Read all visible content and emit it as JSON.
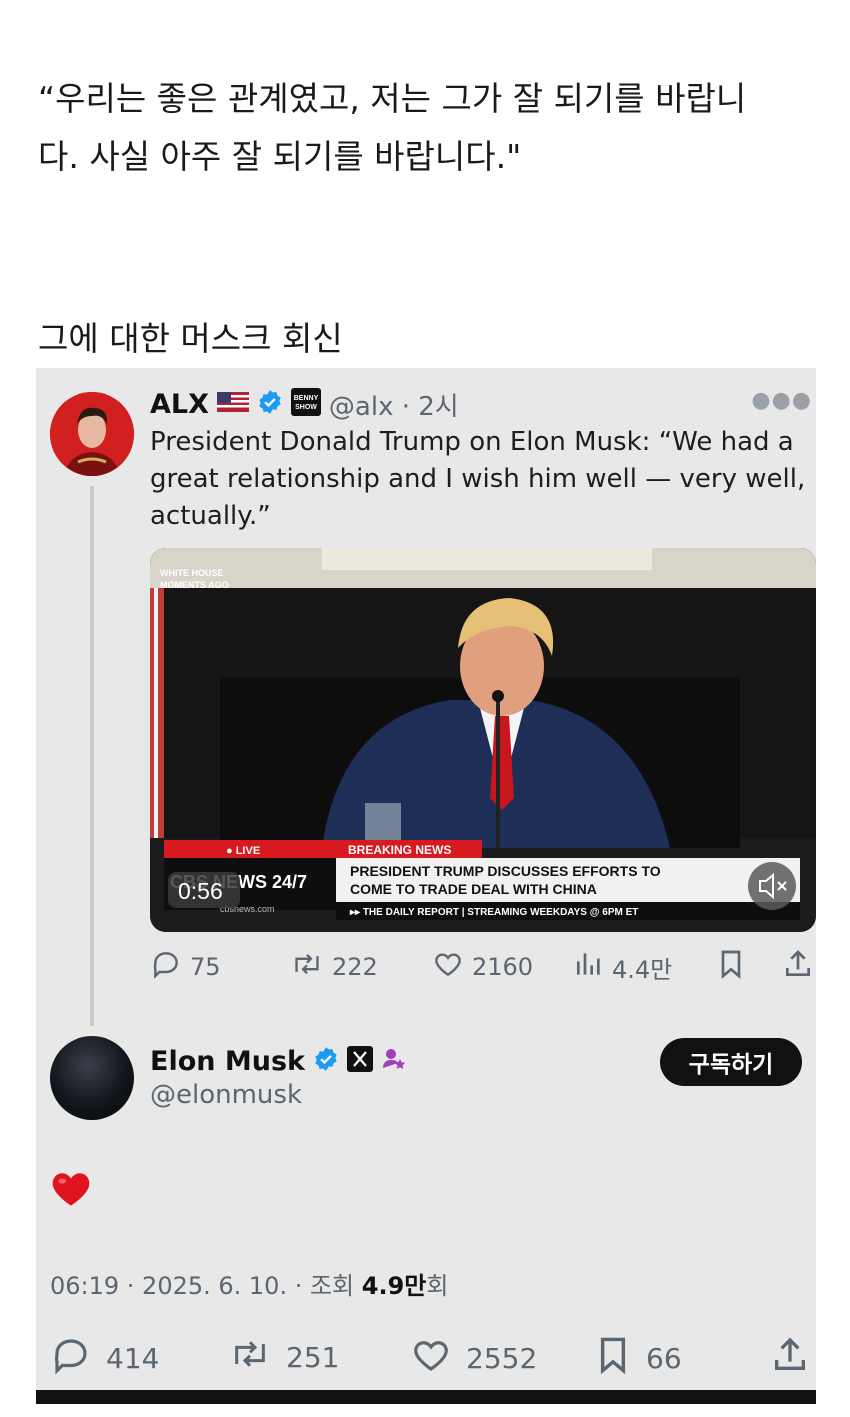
{
  "article": {
    "quote_line1": "“우리는 좋은 관계였고, 저는 그가 잘 되기를 바랍니",
    "quote_line2": "다. 사실 아주 잘 되기를 바랍니다.\"",
    "subtitle": "그에 대한 머스크 회신"
  },
  "tweet": {
    "author_name": "ALX",
    "flag_icon": "us-flag-icon",
    "handle_time": "@alx · 2시",
    "text": "President Donald Trump on Elon Musk: “We had a great relationship and I wish him well — very well, actually.”",
    "badge_logo_text": "BENNY SHOW",
    "video": {
      "corner_tag_line1": "WHITE HOUSE",
      "corner_tag_line2": "MOMENTS AGO",
      "live_label": "● LIVE",
      "breaking_label": "BREAKING NEWS",
      "network_label": "CBS NEWS 24/7",
      "network_url": "cbsnews.com",
      "headline_line1": "PRESIDENT TRUMP DISCUSSES EFFORTS TO",
      "headline_line2": "COME TO TRADE DEAL WITH CHINA",
      "ticker": "▸▸ THE DAILY REPORT | STREAMING WEEKDAYS @ 6PM ET",
      "duration": "0:56"
    },
    "stats": {
      "replies": "75",
      "reposts": "222",
      "likes": "2160",
      "views": "4.4만"
    }
  },
  "reply": {
    "author_name": "Elon Musk",
    "handle": "@elonmusk",
    "subscribe_label": "구독하기",
    "content_icon": "red-heart-emoji",
    "meta_prefix": "06:19 · 2025. 6. 10. · 조회 ",
    "meta_views": "4.9만",
    "meta_suffix": "회",
    "stats": {
      "replies": "414",
      "reposts": "251",
      "likes": "2552",
      "bookmarks": "66"
    }
  },
  "colors": {
    "verified_blue": "#1d9bf0",
    "background": "#e8e8e8",
    "text_secondary": "#5b6670",
    "cbs_red": "#d71920"
  }
}
